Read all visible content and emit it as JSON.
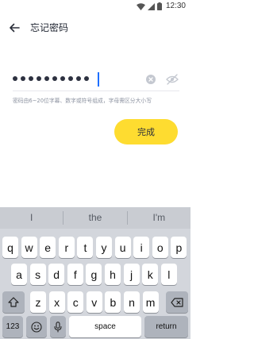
{
  "status_bar": {
    "time": "12:30"
  },
  "header": {
    "title": "忘记密码"
  },
  "password": {
    "masked_length": 10
  },
  "hint": "密码由6~20位字幕、数字或符号组成，字母需区分大小写",
  "button": {
    "done_label": "完成"
  },
  "colors": {
    "accent_yellow": "#fedc30",
    "cursor_blue": "#1d6fff"
  },
  "keyboard": {
    "suggestions": [
      "I",
      "the",
      "I'm"
    ],
    "rows": [
      [
        "q",
        "w",
        "e",
        "r",
        "t",
        "y",
        "u",
        "i",
        "o",
        "p"
      ],
      [
        "a",
        "s",
        "d",
        "f",
        "g",
        "h",
        "j",
        "k",
        "l"
      ],
      [
        "z",
        "x",
        "c",
        "v",
        "b",
        "n",
        "m"
      ]
    ],
    "numbers_label": "123",
    "space_label": "space",
    "return_label": "return"
  },
  "icons": {
    "back": "arrow-left-icon",
    "clear": "clear-circle-icon",
    "visibility": "eye-hidden-icon",
    "shift": "shift-icon",
    "backspace": "backspace-icon",
    "emoji": "emoji-icon",
    "mic": "microphone-icon"
  }
}
